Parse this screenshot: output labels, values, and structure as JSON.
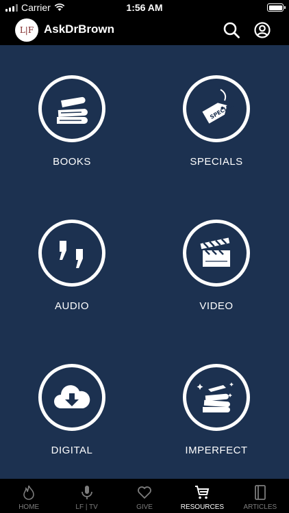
{
  "status": {
    "carrier": "Carrier",
    "time": "1:56 AM"
  },
  "header": {
    "logo_text": "L|F",
    "title": "AskDrBrown"
  },
  "tiles": [
    {
      "label": "BOOKS",
      "icon": "books-icon"
    },
    {
      "label": "SPECIALS",
      "icon": "special-tag-icon"
    },
    {
      "label": "AUDIO",
      "icon": "quote-icon"
    },
    {
      "label": "VIDEO",
      "icon": "clapperboard-icon"
    },
    {
      "label": "DIGITAL",
      "icon": "cloud-download-icon"
    },
    {
      "label": "IMPERFECT",
      "icon": "sparkling-books-icon"
    }
  ],
  "tabs": [
    {
      "label": "HOME",
      "icon": "flame-icon"
    },
    {
      "label": "LF | TV",
      "icon": "microphone-icon"
    },
    {
      "label": "GIVE",
      "icon": "heart-icon"
    },
    {
      "label": "RESOURCES",
      "icon": "cart-icon",
      "active": true
    },
    {
      "label": "ARTICLES",
      "icon": "book-icon"
    }
  ],
  "colors": {
    "main_bg": "#1c3150",
    "bars_bg": "#000000",
    "inactive_tab": "#7d7d7d"
  }
}
